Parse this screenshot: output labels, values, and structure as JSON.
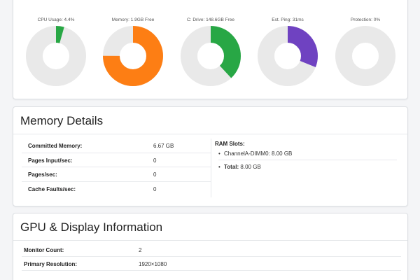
{
  "gauges": [
    {
      "label": "CPU Usage: 4.4%",
      "percent": 4.4,
      "color": "#28a745"
    },
    {
      "label": "Memory: 1.9GB Free",
      "percent": 75,
      "color": "#fd7e14"
    },
    {
      "label": "C: Drive: 148.6GB Free",
      "percent": 38,
      "color": "#28a745"
    },
    {
      "label": "Est. Ping: 31ms",
      "percent": 31,
      "color": "#6f42c1"
    },
    {
      "label": "Protection: 0%",
      "percent": 0,
      "color": "#28a745"
    }
  ],
  "gauge_track_color": "#e9e9e9",
  "memory": {
    "title": "Memory Details",
    "rows": [
      {
        "key": "Committed Memory:",
        "value": "6.67 GB"
      },
      {
        "key": "Pages Input/sec:",
        "value": "0"
      },
      {
        "key": "Pages/sec:",
        "value": "0"
      },
      {
        "key": "Cache Faults/sec:",
        "value": "0"
      }
    ],
    "ram_title": "RAM Slots:",
    "ram_slot": "ChannelA-DIMM0: 8.00 GB",
    "ram_total_label": "Total:",
    "ram_total_value": "8.00 GB"
  },
  "gpu": {
    "title": "GPU & Display Information",
    "rows": [
      {
        "key": "Monitor Count:",
        "value": "2"
      },
      {
        "key": "Primary Resolution:",
        "value": "1920×1080"
      }
    ]
  }
}
